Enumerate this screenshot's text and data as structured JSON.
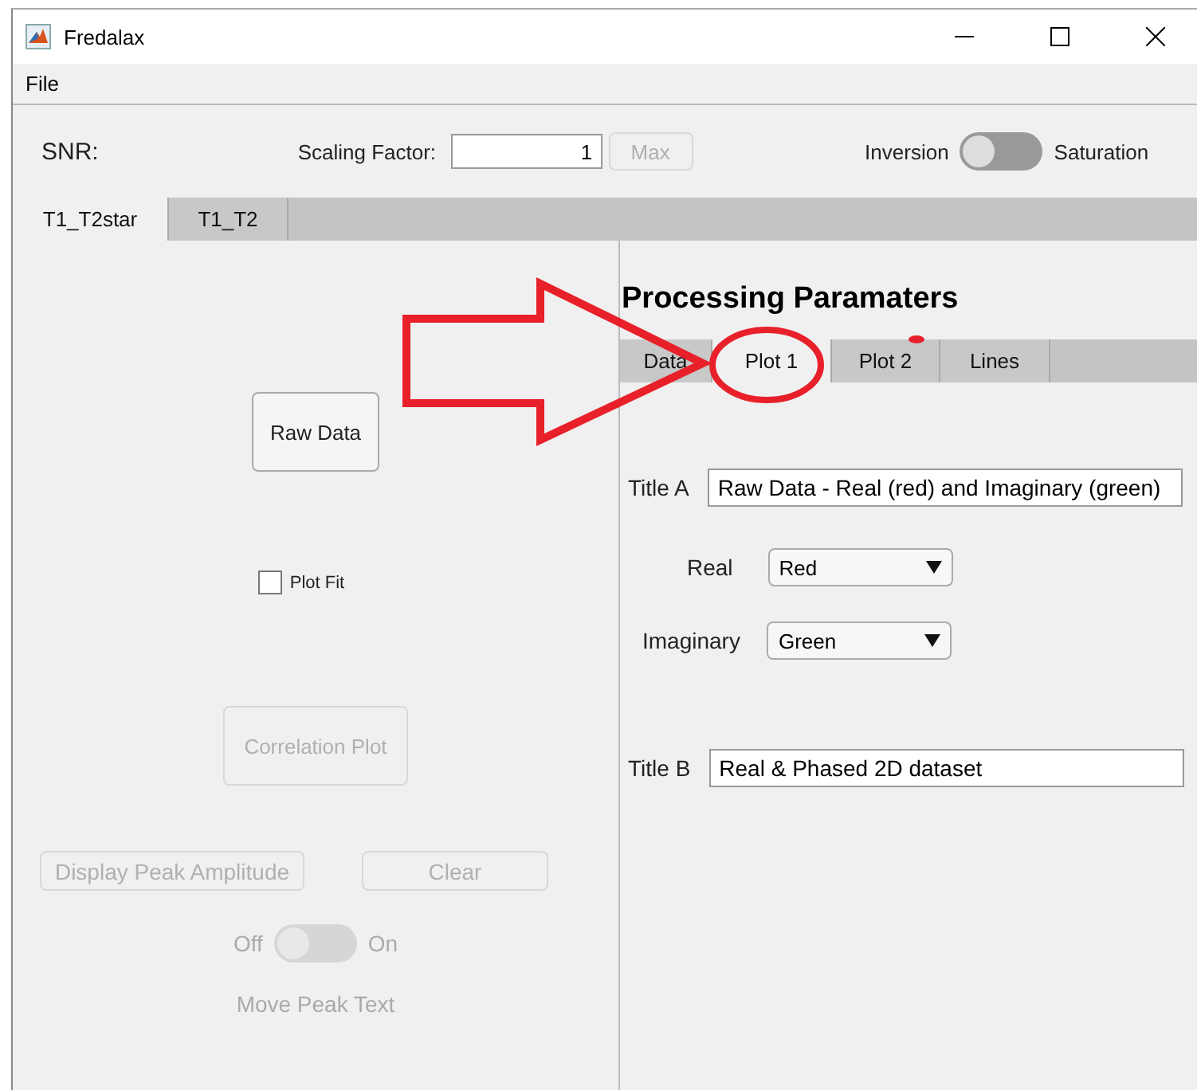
{
  "window": {
    "title": "Fredalax"
  },
  "menu": [
    "File"
  ],
  "toolbar": {
    "snr_label": "SNR:",
    "scaling_label": "Scaling Factor:",
    "scaling_value": "1",
    "max_button": {
      "label": "Max",
      "disabled": true
    },
    "mode_switch": {
      "left_label": "Inversion",
      "right_label": "Saturation",
      "on": false
    }
  },
  "tabs": [
    {
      "label": "T1_T2star",
      "selected": true
    },
    {
      "label": "T1_T2",
      "selected": false
    }
  ],
  "left_panel": {
    "raw_button": {
      "label": "Raw Data",
      "disabled": false
    },
    "plot_fit": {
      "label": "Plot Fit",
      "checked": false
    },
    "correlation_button": {
      "label": "Correlation Plot",
      "disabled": true
    },
    "peak_button": {
      "label": "Display Peak Amplitude",
      "disabled": true
    },
    "clear_button": {
      "label": "Clear",
      "disabled": true
    },
    "peak_switch": {
      "off_label": "Off",
      "on_label": "On",
      "on": false,
      "disabled": true
    },
    "move_label": "Move Peak Text"
  },
  "right_panel": {
    "heading": "Processing Paramaters",
    "tabs": [
      {
        "label": "Data",
        "selected": false
      },
      {
        "label": "Plot 1",
        "selected": true
      },
      {
        "label": "Plot 2",
        "selected": false
      },
      {
        "label": "Lines",
        "selected": false
      }
    ],
    "title_a": {
      "label": "Title A",
      "value": "Raw Data - Real (red) and Imaginary (green)"
    },
    "real": {
      "label": "Real",
      "value": "Red"
    },
    "imaginary": {
      "label": "Imaginary",
      "value": "Green"
    },
    "title_b": {
      "label": "Title B",
      "value": "Real & Phased 2D dataset"
    }
  }
}
